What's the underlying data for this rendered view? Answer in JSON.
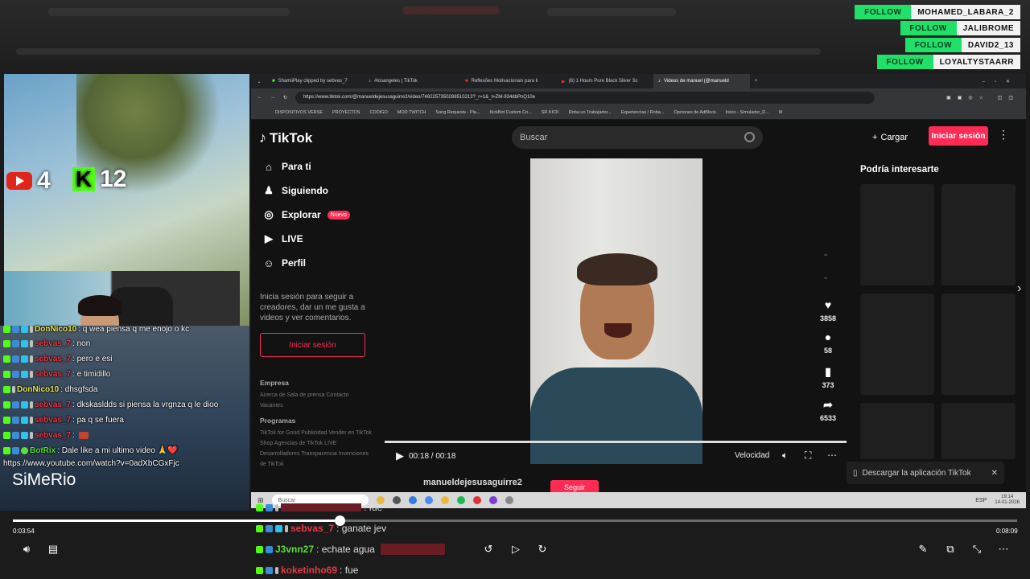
{
  "follows": [
    {
      "label": "FOLLOW",
      "user": "MOHAMED_LABARA_2"
    },
    {
      "label": "FOLLOW",
      "user": "JALIBROME"
    },
    {
      "label": "FOLLOW",
      "user": "DAVID2_13"
    },
    {
      "label": "FOLLOW",
      "user": "LOYALTYSTAARR"
    }
  ],
  "counters": {
    "youtube": "4",
    "kick": "12"
  },
  "chat": [
    {
      "user": "DonNico10",
      "msg": ": q wea piensa q me enojo o kc",
      "color": "yellow"
    },
    {
      "user": "sebvas_7",
      "msg": ": non",
      "color": "red"
    },
    {
      "user": "sebvas_7",
      "msg": ": pero e esi",
      "color": "red"
    },
    {
      "user": "sebvas_7",
      "msg": ": e timidillo",
      "color": "red"
    },
    {
      "user": "DonNico10",
      "msg": ": dhsgfsda",
      "color": "yellow"
    },
    {
      "user": "sebvas_7",
      "msg": ": dkskasldds si piensa la vrgnza q le dioo",
      "color": "red"
    },
    {
      "user": "sebvas_7",
      "msg": ": pa q se fuera",
      "color": "red"
    },
    {
      "user": "sebvas_7",
      "msg": ":",
      "color": "red"
    },
    {
      "user": "BotRix",
      "msg": ": Dale like a mi ultimo video 🙏❤️",
      "color": "green"
    }
  ],
  "chat_link": "https://www.youtube.com/watch?v=0adXbCGxFjc",
  "streamer_name": "SiMeRio",
  "browser": {
    "tabs": [
      "ShamiiPlay clipped by sebvas_7",
      "#losangeles | TikTok",
      "Reflexões Motivacionais para li",
      "(8) 1 Hours Pure Black Silver Sc",
      "Videos de manuel (@manueld"
    ],
    "url": "https://www.tiktok.com/@manueldejesusaguirre2/video/7482257350288510213?_r=1&_t=ZM-934dbPnQ10e",
    "bookmarks": [
      "DISPOSITIVOS VERSE",
      "PROYECTOS",
      "CODIGO",
      "MOD TWITCH",
      "Song Requests - Pla...",
      "KickBot Custom Co...",
      "SR KICK",
      "Roba un Trabajador...",
      "Experiencias / Roba...",
      "Opciones de AdBlock",
      "Inicio - Simulador_D...",
      "M"
    ]
  },
  "tiktok": {
    "logo": "TikTok",
    "search_placeholder": "Buscar",
    "upload": "Cargar",
    "login": "Iniciar sesión",
    "nav": [
      {
        "icon": "⌂",
        "label": "Para ti"
      },
      {
        "icon": "♟",
        "label": "Siguiendo"
      },
      {
        "icon": "◎",
        "label": "Explorar"
      },
      {
        "icon": "▶",
        "label": "LIVE"
      },
      {
        "icon": "☺",
        "label": "Perfil"
      }
    ],
    "new_badge": "Nuevo",
    "side_text": "Inicia sesión para seguir a creadores, dar un me gusta a videos y ver comentarios.",
    "side_login": "Iniciar sesión",
    "footer": {
      "empresa": "Empresa",
      "empresa_links": "Acerca de  Sala de prensa  Contacto  Vacantes",
      "programas": "Programas",
      "programas_links": "TikTok for Good  Publicidad  Vender en TikTok Shop  Agencias de TikTok LIVE  Desarrolladores  Transparencia  Invenciones de TikTok"
    },
    "time": "00:18 / 00:18",
    "speed": "Velocidad",
    "likes": "3858",
    "comments": "58",
    "saves": "373",
    "shares": "6533",
    "recommend_title": "Podría interesarte",
    "download_app": "Descargar la aplicación TikTok",
    "author": "manueldejesusaguirre2",
    "follow": "Seguir"
  },
  "taskbar": {
    "search": "Buscar",
    "time": "19:14",
    "date": "14-01-2026",
    "lang": "ESP"
  },
  "player": {
    "elapsed": "0:03:54",
    "total": "0:08:09",
    "progress": 0.325
  },
  "bottom_chat": [
    {
      "user": "",
      "msg": ": fue",
      "color": "red"
    },
    {
      "user": "sebvas_7",
      "msg": ": ganate jev",
      "color": "red"
    },
    {
      "user": "J3vnn27",
      "msg": ": echate agua",
      "color": "green"
    },
    {
      "user": "koketinho69",
      "msg": ": fue",
      "color": "red"
    }
  ]
}
